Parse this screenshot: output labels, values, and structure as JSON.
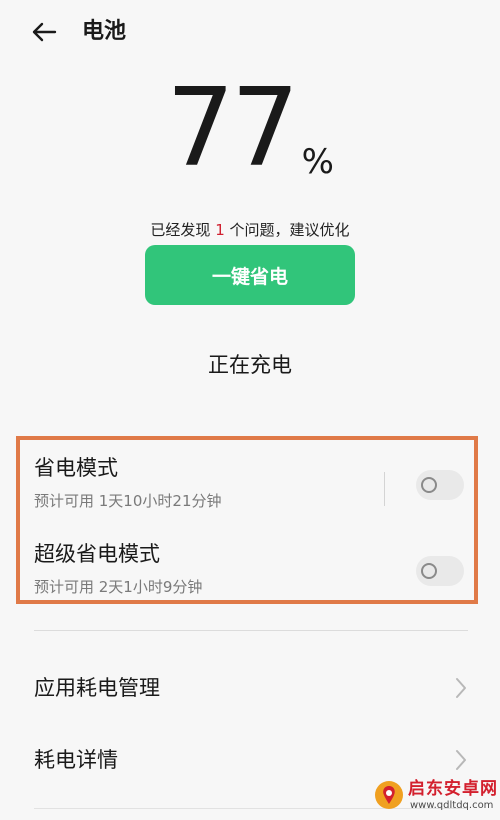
{
  "header": {
    "title": "电池"
  },
  "battery": {
    "level": "77",
    "unit": "%"
  },
  "issues": {
    "prefix": "已经发现",
    "count": "1",
    "suffix": "个问题，建议优化"
  },
  "optimize_button": {
    "label": "一键省电",
    "color": "#31c57a"
  },
  "charging_status": "正在充电",
  "modes": [
    {
      "title": "省电模式",
      "subtitle": "预计可用 1天10小时21分钟",
      "enabled": false
    },
    {
      "title": "超级省电模式",
      "subtitle": "预计可用 2天1小时9分钟",
      "enabled": false
    }
  ],
  "highlight_color": "#e07a48",
  "list_items": [
    {
      "label": "应用耗电管理",
      "icon": "chevron-right-icon"
    },
    {
      "label": "耗电详情",
      "icon": "chevron-right-icon"
    }
  ],
  "watermark": {
    "name": "启东安卓网",
    "url": "www.qdltdq.com"
  }
}
